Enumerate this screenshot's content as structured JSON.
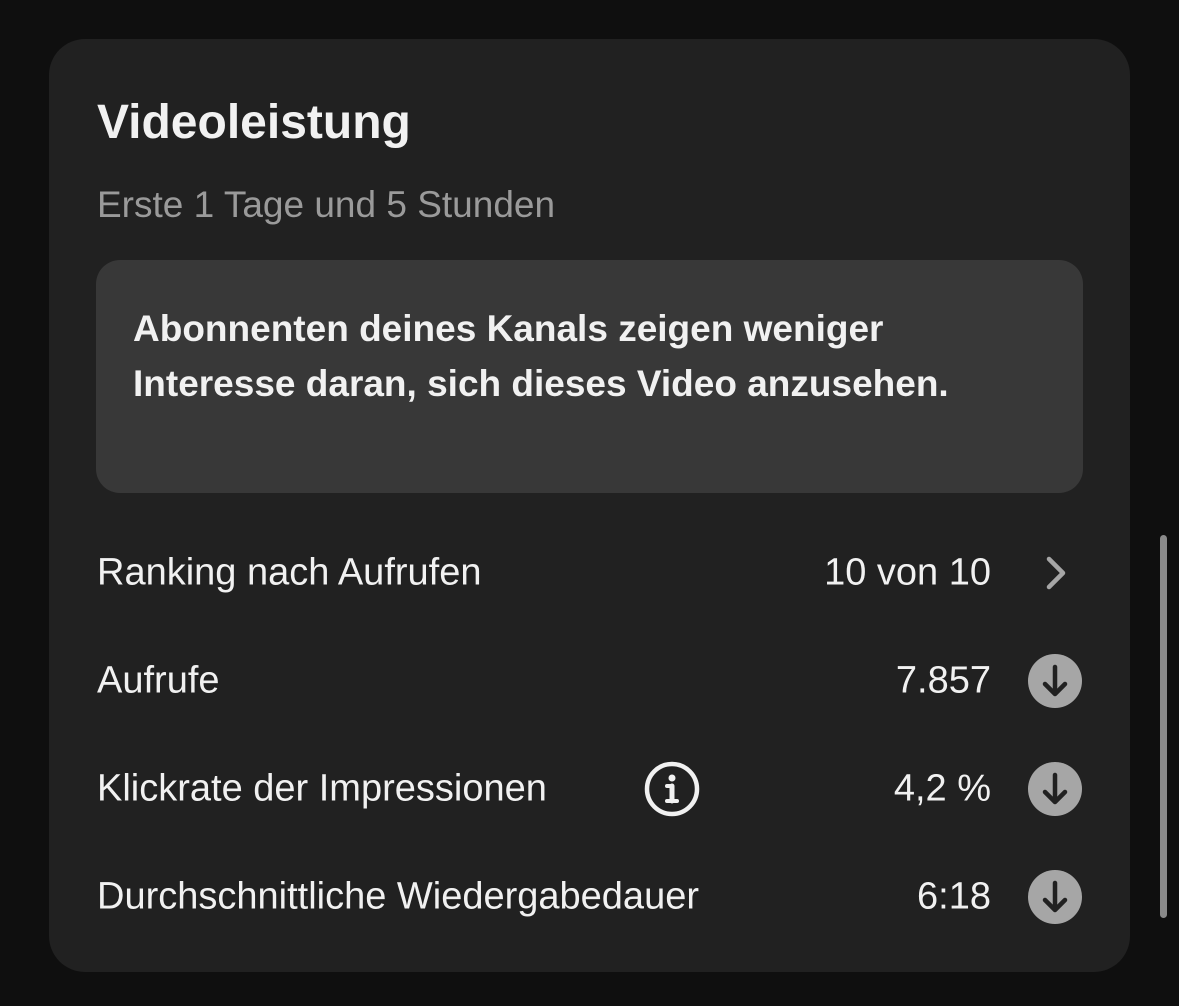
{
  "card": {
    "title": "Videoleistung",
    "subtitle": "Erste 1 Tage und 5 Stunden",
    "insight": "Abonnenten deines Kanals zeigen weniger Interesse daran, sich dieses Video anzusehen."
  },
  "rows": [
    {
      "label": "Ranking nach Aufrufen",
      "value": "10 von 10",
      "icon": "chevron-right-icon"
    },
    {
      "label": "Aufrufe",
      "value": "7.857",
      "icon": "arrow-down-circle-icon"
    },
    {
      "label": "Klickrate der Impressionen",
      "value": "4,2 %",
      "icon": "arrow-down-circle-icon",
      "info_icon": "info-circle-icon"
    },
    {
      "label": "Durchschnittliche Wiedergabedauer",
      "value": "6:18",
      "icon": "arrow-down-circle-icon"
    }
  ],
  "colors": {
    "background": "#0f0f0f",
    "card": "#212121",
    "insight_box": "#383838",
    "text": "#f1f1f1",
    "secondary_text": "#9a9a9a",
    "indicator_circle": "#a6a6a6"
  }
}
